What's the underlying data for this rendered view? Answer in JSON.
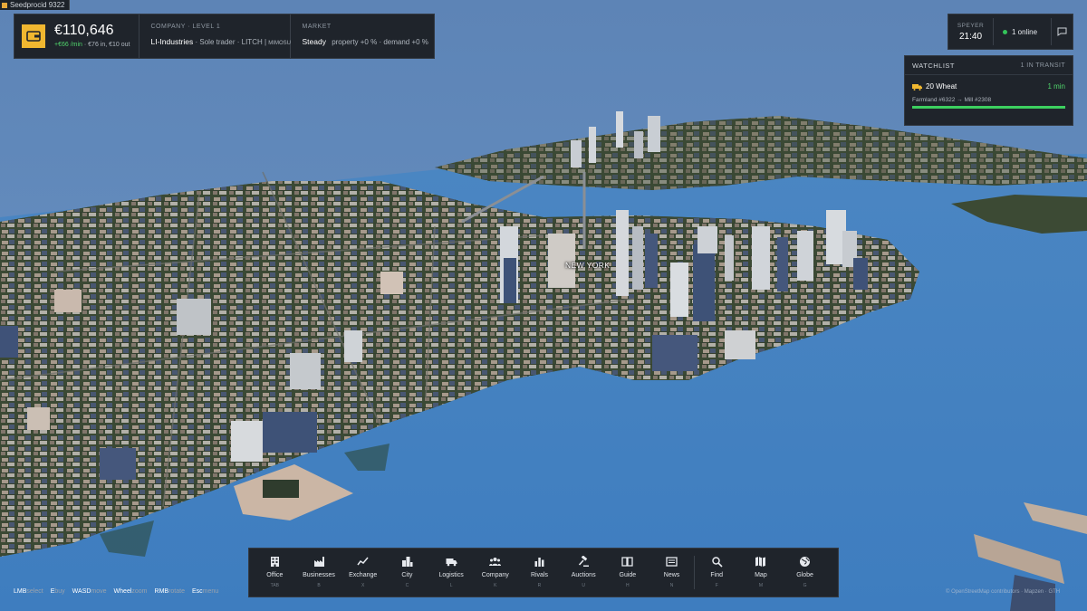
{
  "debug": {
    "text": "Seedprocid 9322"
  },
  "money": {
    "amount": "€110,646",
    "rate": "+€66 /min",
    "in_out": "· €76 in, €10 out"
  },
  "company": {
    "label": "COMPANY · LEVEL 1",
    "name": "LI-Industries",
    "details": "· Sole trader · LITCH |",
    "tag": "MIMOSU"
  },
  "market": {
    "label": "MARKET",
    "status": "Steady",
    "details": "property +0 % · demand +0 %"
  },
  "clock": {
    "city": "SPEYER",
    "time": "21:40",
    "online": "1 online"
  },
  "watchlist": {
    "title": "WATCHLIST",
    "transit": "1 IN TRANSIT",
    "items": [
      {
        "cargo": "20 Wheat",
        "eta": "1 min",
        "route": "Farmland #6322 → Mill #2308",
        "progress": 1.0
      }
    ]
  },
  "map": {
    "city_label": "NEW YORK"
  },
  "toolbar": {
    "items": [
      {
        "label": "Office",
        "key": "TAB",
        "icon": "office-building-icon"
      },
      {
        "label": "Businesses",
        "key": "B",
        "icon": "factory-icon"
      },
      {
        "label": "Exchange",
        "key": "X",
        "icon": "chart-line-icon"
      },
      {
        "label": "City",
        "key": "C",
        "icon": "city-icon"
      },
      {
        "label": "Logistics",
        "key": "L",
        "icon": "truck-icon"
      },
      {
        "label": "Company",
        "key": "K",
        "icon": "people-icon"
      },
      {
        "label": "Rivals",
        "key": "R",
        "icon": "bar-chart-icon"
      },
      {
        "label": "Auctions",
        "key": "U",
        "icon": "gavel-icon"
      },
      {
        "label": "Guide",
        "key": "H",
        "icon": "book-icon"
      },
      {
        "label": "News",
        "key": "N",
        "icon": "newspaper-icon"
      },
      {
        "label": "Find",
        "key": "F",
        "icon": "search-icon"
      },
      {
        "label": "Map",
        "key": "M",
        "icon": "map-icon"
      },
      {
        "label": "Globe",
        "key": "G",
        "icon": "globe-icon"
      }
    ]
  },
  "hints": [
    {
      "key": "LMB",
      "action": "select"
    },
    {
      "key": "E",
      "action": "buy"
    },
    {
      "key": "WASD",
      "action": "move"
    },
    {
      "key": "Wheel",
      "action": "zoom"
    },
    {
      "key": "RMB",
      "action": "rotate"
    },
    {
      "key": "Esc",
      "action": "menu"
    }
  ],
  "attribution": "© OpenStreetMap contributors · Mapzen · GTH",
  "colors": {
    "accent": "#f0b730",
    "positive": "#4fd36b",
    "panel": "#1f242b",
    "water": "#4a86c4",
    "land": "#3f4e37"
  }
}
